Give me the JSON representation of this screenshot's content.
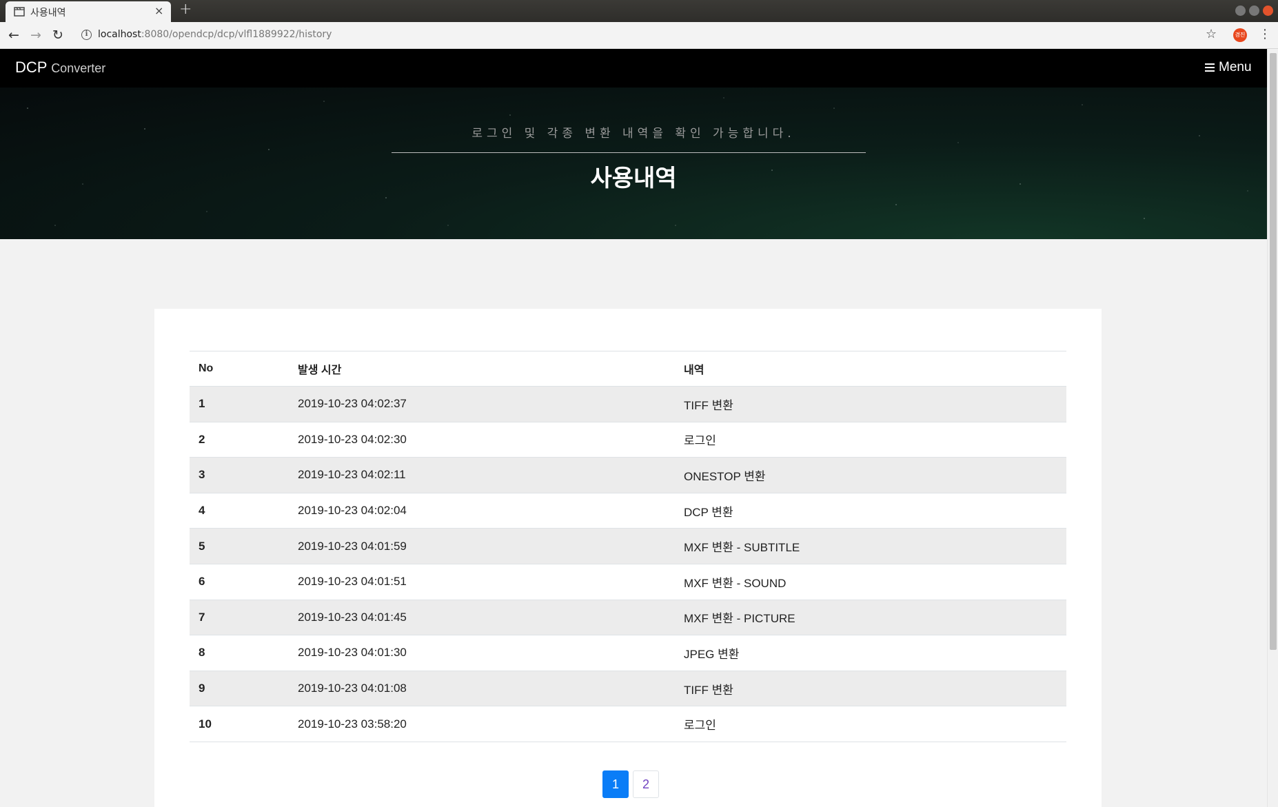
{
  "browser": {
    "tab_title": "사용내역",
    "new_tab_label": "+",
    "tab_close_label": "×",
    "url_host": "localhost",
    "url_rest": ":8080/opendcp/dcp/vlfl1889922/history",
    "profile_initials": "경진",
    "icons": [
      "back-arrow-icon",
      "forward-arrow-icon",
      "reload-icon",
      "info-icon",
      "star-icon",
      "kebab-menu-icon",
      "tab-page-icon"
    ]
  },
  "navbar": {
    "brand_main": "DCP",
    "brand_sub": "Converter",
    "menu_label": "Menu"
  },
  "hero": {
    "subtitle": "로그인 및 각종 변환 내역을 확인 가능합니다.",
    "title": "사용내역"
  },
  "table": {
    "headers": [
      "No",
      "발생 시간",
      "내역"
    ],
    "rows": [
      {
        "no": "1",
        "time": "2019-10-23 04:02:37",
        "desc": "TIFF 변환"
      },
      {
        "no": "2",
        "time": "2019-10-23 04:02:30",
        "desc": "로그인"
      },
      {
        "no": "3",
        "time": "2019-10-23 04:02:11",
        "desc": "ONESTOP 변환"
      },
      {
        "no": "4",
        "time": "2019-10-23 04:02:04",
        "desc": "DCP 변환"
      },
      {
        "no": "5",
        "time": "2019-10-23 04:01:59",
        "desc": "MXF 변환 - SUBTITLE"
      },
      {
        "no": "6",
        "time": "2019-10-23 04:01:51",
        "desc": "MXF 변환 - SOUND"
      },
      {
        "no": "7",
        "time": "2019-10-23 04:01:45",
        "desc": "MXF 변환 - PICTURE"
      },
      {
        "no": "8",
        "time": "2019-10-23 04:01:30",
        "desc": "JPEG 변환"
      },
      {
        "no": "9",
        "time": "2019-10-23 04:01:08",
        "desc": "TIFF 변환"
      },
      {
        "no": "10",
        "time": "2019-10-23 03:58:20",
        "desc": "로그인"
      }
    ]
  },
  "pagination": {
    "pages": [
      "1",
      "2"
    ],
    "current": "1"
  },
  "colors": {
    "navbar_bg": "#000000",
    "active_page": "#0a7df7",
    "page_link": "#6f42c1",
    "striped_row": "#ececec"
  }
}
